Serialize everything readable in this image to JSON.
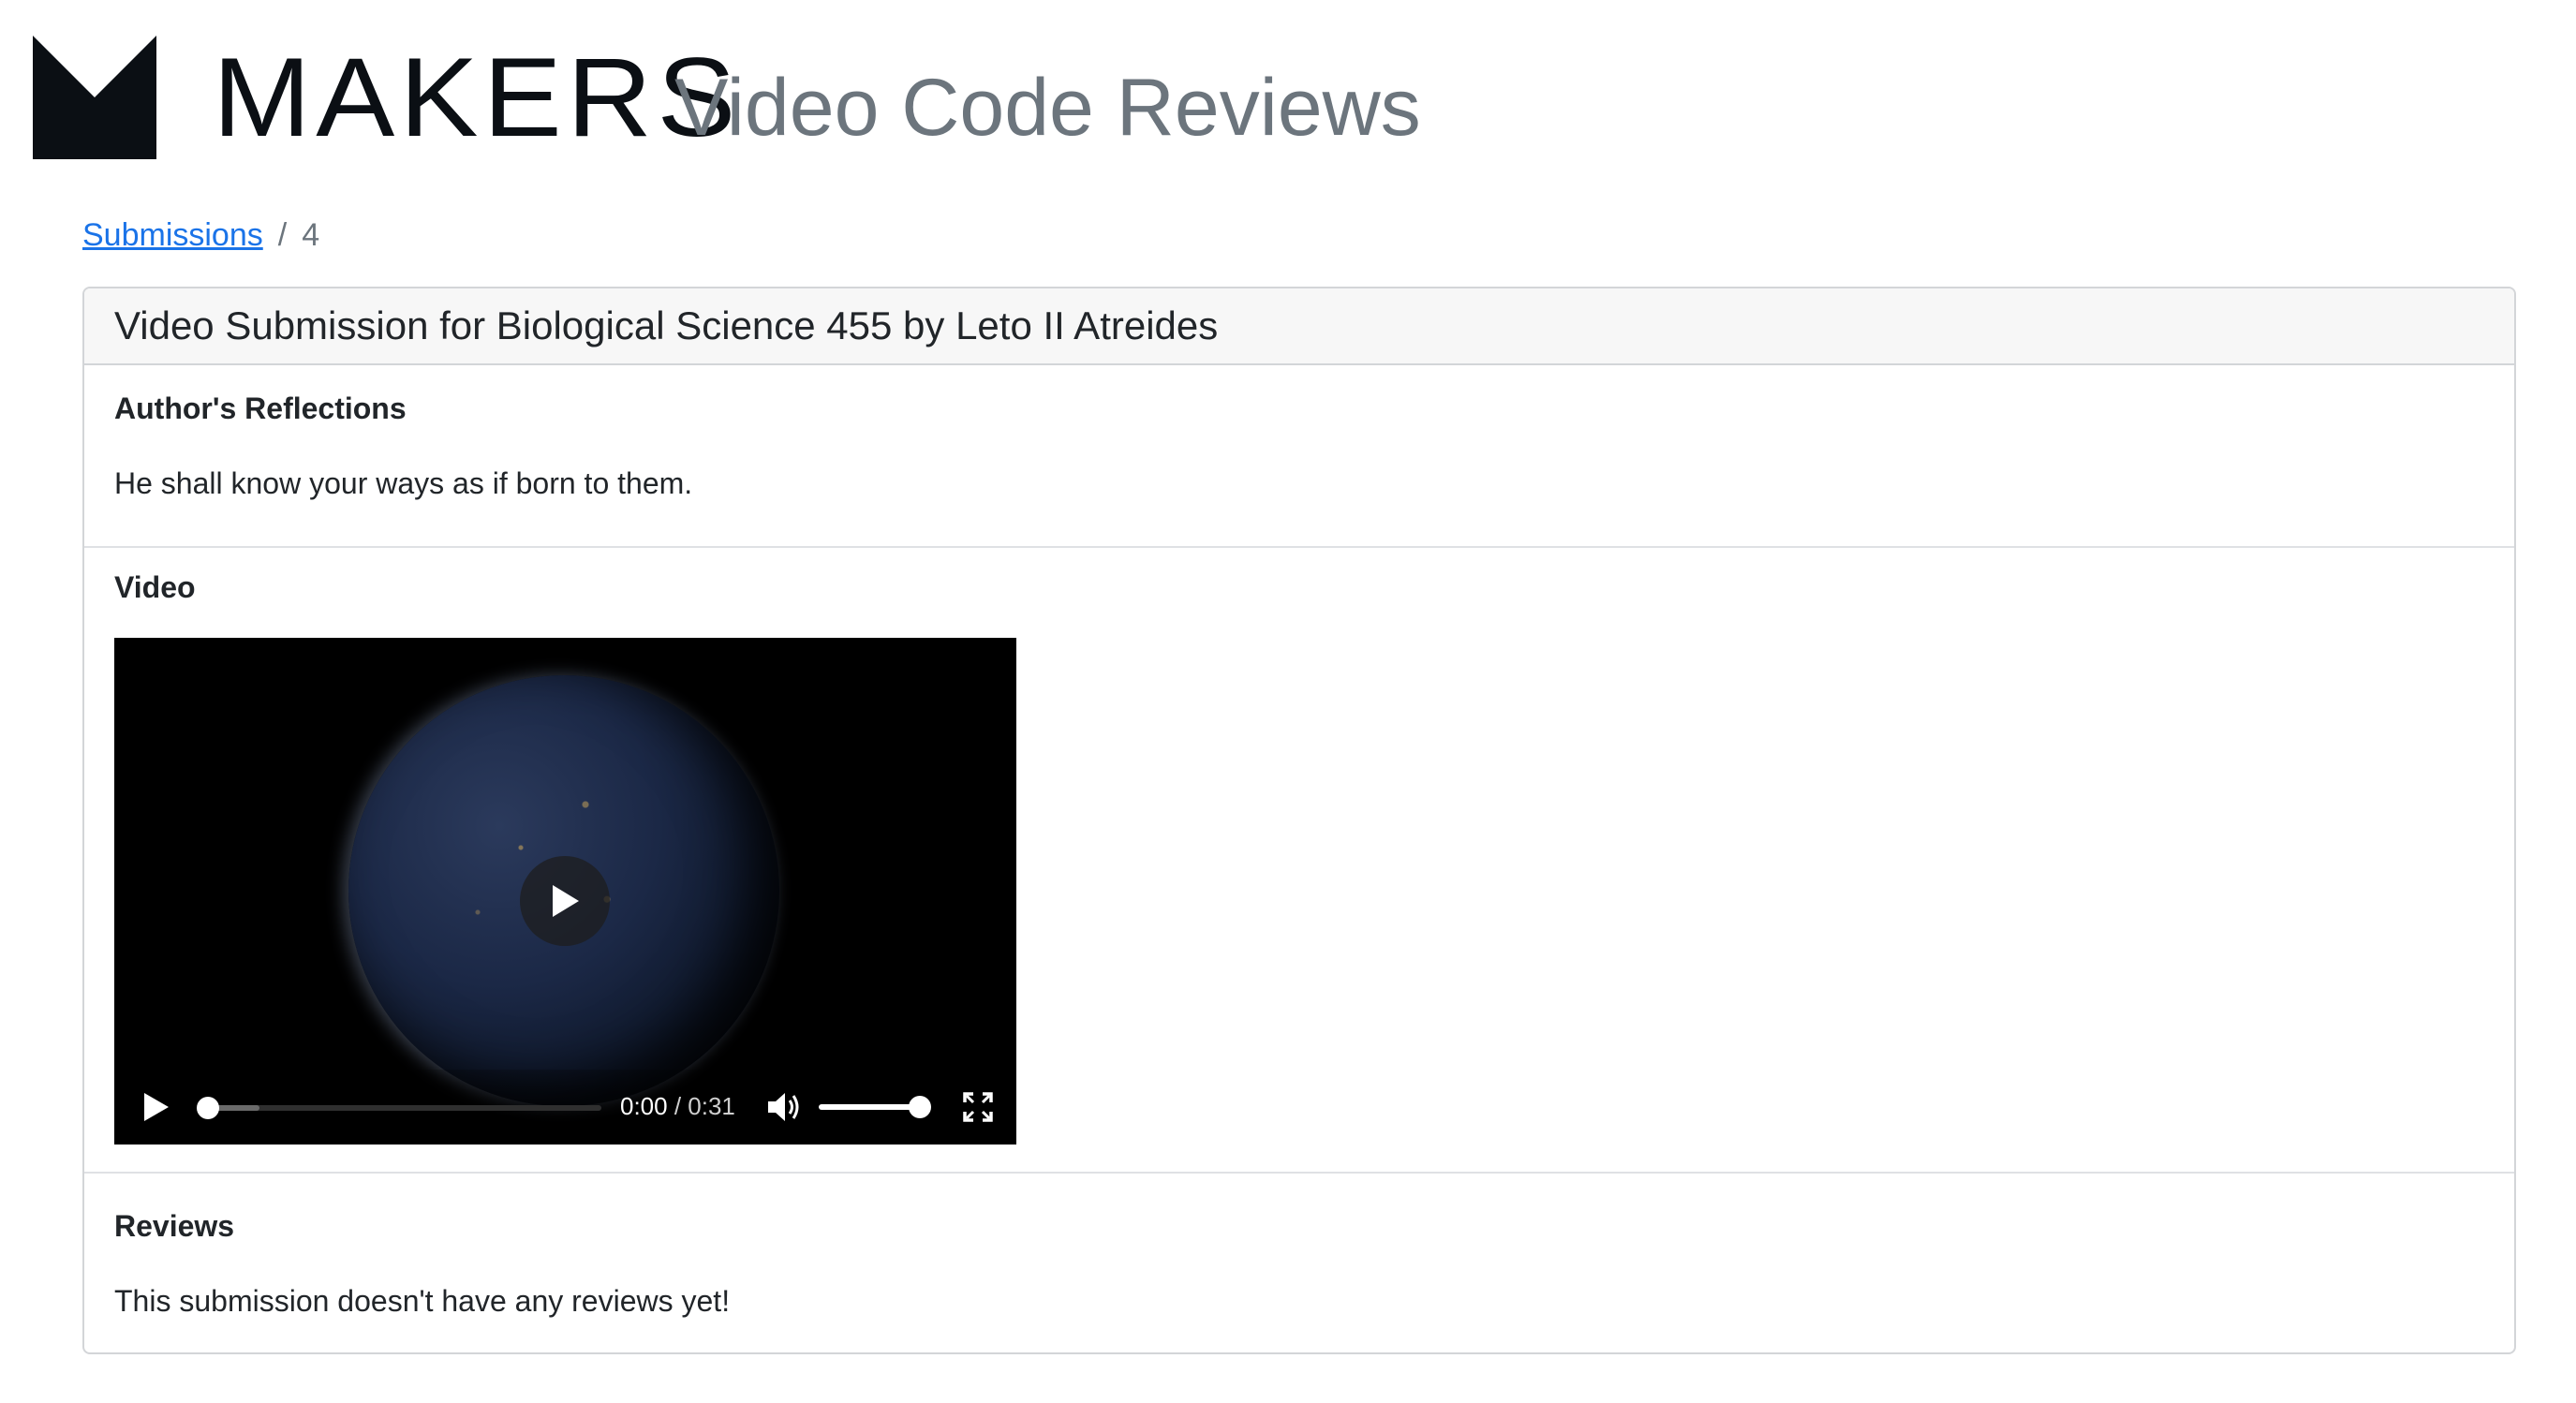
{
  "brand": {
    "wordmark": "MAKERS",
    "app_title": "Video Code Reviews",
    "logo_icon": "makers-logo-icon"
  },
  "breadcrumb": {
    "link_label": "Submissions",
    "separator": "/",
    "current": "4"
  },
  "submission": {
    "title": "Video Submission for Biological Science 455 by Leto II Atreides",
    "reflections_heading": "Author's Reflections",
    "reflections_text": "He shall know your ways as if born to them.",
    "video_heading": "Video",
    "reviews_heading": "Reviews",
    "reviews_text": "This submission doesn't have any reviews yet!"
  },
  "video_player": {
    "current_time": "0:00",
    "duration": "0:31",
    "time_separator": " / ",
    "played_fraction": 0.0,
    "volume_fraction": 1.0,
    "icons": [
      "big-play-icon",
      "play-icon",
      "volume-icon",
      "fullscreen-icon"
    ]
  },
  "colors": {
    "link": "#1a73e8",
    "muted": "#6c757d",
    "card_border": "#d3d5d8",
    "card_header_bg": "#f7f7f7"
  }
}
